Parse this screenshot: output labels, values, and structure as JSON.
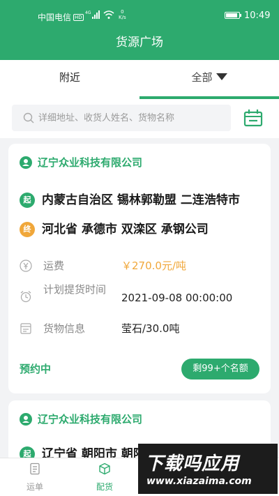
{
  "status_bar": {
    "carrier": "中国电信",
    "hd_badge": "HD",
    "network": "4G",
    "speed_value": "0",
    "speed_unit": "K/s",
    "time": "10:49"
  },
  "header": {
    "title": "货源广场"
  },
  "tabs": [
    {
      "label": "附近",
      "active": false
    },
    {
      "label": "全部",
      "active": true
    }
  ],
  "search": {
    "placeholder": "详细地址、收货人姓名、货物名称"
  },
  "cards": [
    {
      "company": "辽宁众业科技有限公司",
      "start_badge": "起",
      "start_address": "内蒙古自治区 锡林郭勒盟 二连浩特市",
      "end_badge": "终",
      "end_address": "河北省 承德市 双滦区 承钢公司",
      "freight_label": "运费",
      "freight_value": "￥270.0元/吨",
      "pickup_label": "计划提货时间",
      "pickup_value": "2021-09-08 00:00:00",
      "goods_label": "货物信息",
      "goods_value": "莹石/30.0吨",
      "status": "预约中",
      "quota": "剩99+个名额"
    },
    {
      "company": "辽宁众业科技有限公司",
      "start_address_partial": "辽宁省 朝阳市 朝阳县 柳城镇"
    }
  ],
  "bottom_nav": [
    {
      "label": "运单",
      "active": false,
      "icon": "document-icon"
    },
    {
      "label": "配货",
      "active": true,
      "icon": "box-icon"
    }
  ],
  "watermark": {
    "title": "下载吗应用",
    "url": "www.xiazaima.com"
  },
  "colors": {
    "primary": "#2daa6e",
    "accent_orange": "#f0a73a",
    "text_gray": "#888888"
  }
}
